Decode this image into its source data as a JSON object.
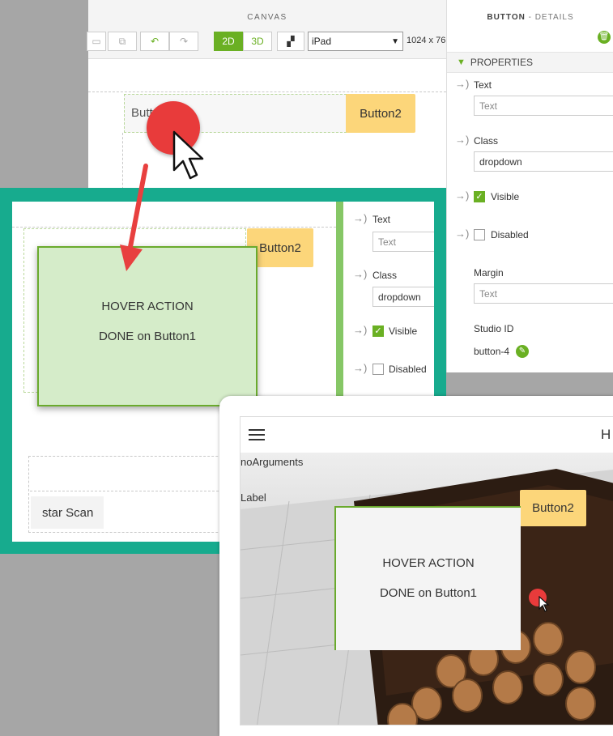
{
  "editor": {
    "canvas_title": "CANVAS",
    "toolbar": {
      "mode_2d": "2D",
      "mode_3d": "3D",
      "device": "iPad",
      "resolution": "1024 x 76"
    },
    "canvas": {
      "button1_label": "Butt",
      "button2_label": "Button2"
    },
    "details": {
      "title_bold": "BUTTON",
      "title_rest": " - DETAILS",
      "properties_label": "PROPERTIES",
      "text_label": "Text",
      "text_placeholder": "Text",
      "class_label": "Class",
      "class_value": "dropdown",
      "visible_label": "Visible",
      "disabled_label": "Disabled",
      "margin_label": "Margin",
      "margin_placeholder": "Text",
      "studio_id_label": "Studio ID",
      "studio_id_value": "button-4"
    }
  },
  "zoom": {
    "button2_label": "Button2",
    "hover_line1": "HOVER ACTION",
    "hover_line2": "DONE on Button1",
    "scan_label": "star Scan",
    "panel": {
      "text_label": "Text",
      "text_placeholder": "Text",
      "class_label": "Class",
      "class_value": "dropdown",
      "visible_label": "Visible",
      "disabled_label": "Disabled"
    }
  },
  "preview": {
    "header_text": "H",
    "no_arguments": "noArguments",
    "label_text": "Label",
    "button2_label": "Button2",
    "hover_line1": "HOVER ACTION",
    "hover_line2": "DONE on Button1"
  },
  "colors": {
    "accent_green": "#6ab023",
    "teal_frame": "#17ab8e",
    "button_yellow": "#fcd67a",
    "cursor_red": "#e83b3b"
  }
}
